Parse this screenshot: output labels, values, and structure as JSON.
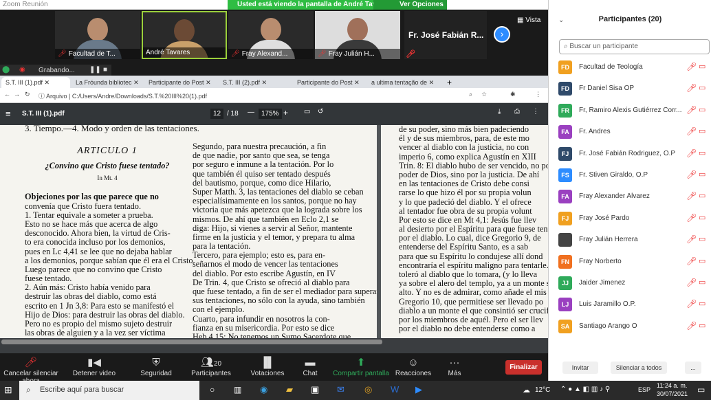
{
  "zoom": {
    "window_title": "Zoom Reunión",
    "share_banner": "Usted está viendo la pantalla de André Tavares",
    "view_options": "Ver Opciones",
    "view_label": "Vista",
    "recording": "Grabando..."
  },
  "video_tiles": [
    {
      "name": "Facultad de T..."
    },
    {
      "name": "André Tavares"
    },
    {
      "name": "Fray Alexand..."
    },
    {
      "name": "Fray Julián H..."
    }
  ],
  "next_tile_name": "Fr. José Fabián R...",
  "browser": {
    "tabs": [
      "S.T. III (1).pdf",
      "La Fróunda bibliotec",
      "Participante do Post",
      "S.T. III (2).pdf",
      "Participante do Post",
      "a ultima tentação de"
    ],
    "address_prefix": "Arquivo",
    "address": "C:/Users/Andre/Downloads/S.T.%20III%20(1).pdf"
  },
  "pdf": {
    "filename": "S.T. III (1).pdf",
    "page_current": "12",
    "page_total": "/ 18",
    "zoom": "175%"
  },
  "doc": {
    "col1": [
      "3.   Tiempo.—4.   Modo y orden de las tentaciones.",
      "",
      "ARTICULO 1",
      "¿Convino que Cristo fuese tentado?",
      "In Mt. 4",
      "",
      "Objeciones por las que parece que no",
      "convenía que Cristo fuera tentado.",
      "1.  Tentar equivale a someter a prueba.",
      "Esto no se hace más que acerca de algo",
      "desconocido. Ahora bien, la virtud de Cris-",
      "to era conocida incluso por los demonios,",
      "pues en Lc 4,41 se lee que no dejaba hablar",
      "a los demonios, porque sabían que él era el Cristo.",
      "Luego parece que no convino que Cristo",
      "fuese tentado.",
      "2.  Aún más: Cristo había venido para",
      "destruir las obras del diablo, como está",
      "escrito en 1 Jn 3,8: Para esto se manifestó el",
      "Hijo de Dios: para destruir las obras del diablo.",
      "Pero no es propio del mismo sujeto destruir",
      "las obras de alguien y a la vez ser víctima"
    ],
    "col2": [
      "Segundo, para nuestra precaución, a fin",
      "de que nadie, por santo que sea, se tenga",
      "por seguro e inmune a la tentación. Por lo",
      "que también él quiso ser tentado después",
      "del bautismo, porque, como dice Hilario,",
      "Super Matth. 3, las tentaciones del diablo se ceban",
      "especialísimamente en los santos, porque no hay",
      "victoria que más apetezca que la lograda sobre los",
      "mismos. De ahí que también en Eclo 2,1 se",
      "diga: Hijo, si vienes a servir al Señor, mantente",
      "firme en la justicia y el temor, y prepara tu alma",
      "para la tentación.",
      "Tercero, para ejemplo; esto es, para en-",
      "señarnos el modo de vencer las tentaciones",
      "del diablo. Por esto escribe Agustín, en IV",
      "De Trin. 4, que Cristo se ofreció al diablo para",
      "que fuese tentado, a fin de ser el mediador para superar",
      "sus tentaciones, no sólo con la ayuda, sino también",
      "con el ejemplo.",
      "Cuarto, para infundir en nosotros la con-",
      "fianza en su misericordia. Por esto se dice",
      "Heb 4,15: No tenemos un Sumo Sacerdote que"
    ],
    "col3": [
      "de su poder, sino más bien padeciendo",
      "él y de sus miembros, para, de este mo",
      "vencer al diablo con la justicia, no con",
      "imperio 6, como explica Agustín en XIII",
      "Trin. 8: El diablo hubo de ser vencido, no po",
      "poder de Dios, sino por la justicia. De ahí",
      "en las tentaciones de Cristo debe consi",
      "rarse lo que hizo él por su propia volun",
      "y lo que padeció del diablo. Y el ofrece",
      "al tentador fue obra de su propia volunt",
      "Por esto se dice en Mt 4,1: Jesús fue llev",
      "al desierto por el Espíritu para que fuese tent",
      "por el diablo. Lo cual, dice Gregorio 9, de",
      "entenderse del Espíritu Santo, es a sab",
      "para que su Espíritu lo condujese allí dond",
      "encontraría el espíritu maligno para tentarle. P",
      "toleró al diablo que lo tomara, (y lo lleva",
      "ya sobre el alero del templo, ya a un monte s",
      "alto. Y no es de admirar, como añade el mis",
      "Gregorio 10, que permitiese ser llevado po",
      "diablo a un monte el que consintió ser crucifi",
      "por los miembros de aquél. Pero el ser llev",
      "por el diablo no debe entenderse como a"
    ]
  },
  "controls": [
    {
      "icon": "mic-muted-icon",
      "label": "Cancelar silenciar ahora"
    },
    {
      "icon": "camera-icon",
      "label": "Detener video"
    },
    {
      "icon": "shield-icon",
      "label": "Seguridad"
    },
    {
      "icon": "people-icon",
      "label": "Participantes",
      "badge": "20"
    },
    {
      "icon": "chart-icon",
      "label": "Votaciones"
    },
    {
      "icon": "chat-icon",
      "label": "Chat"
    },
    {
      "icon": "share-icon",
      "label": "Compartir pantalla"
    },
    {
      "icon": "emoji-icon",
      "label": "Reacciones"
    },
    {
      "icon": "more-icon",
      "label": "Más"
    }
  ],
  "end_button": "Finalizar",
  "participants": {
    "title": "Participantes (20)",
    "search_placeholder": "Buscar un participante",
    "list": [
      {
        "initials": "FD",
        "name": "Facultad de Teología",
        "color": "#f0a020"
      },
      {
        "initials": "FD",
        "name": "Fr Daniel Sisa OP",
        "color": "#2f4a6a"
      },
      {
        "initials": "FR",
        "name": "Fr, Ramiro Alexis Gutiérrez Corr...",
        "color": "#2faa5a"
      },
      {
        "initials": "FA",
        "name": "Fr. Andres",
        "color": "#9a40c0"
      },
      {
        "initials": "FJ",
        "name": "Fr. José Fabián Rodriguez, O.P",
        "color": "#2f4a6a"
      },
      {
        "initials": "FS",
        "name": "Fr. Stiven Giraldo, O.P",
        "color": "#2d8cff"
      },
      {
        "initials": "FA",
        "name": "Fray Alexander Alvarez",
        "color": "#9a40c0"
      },
      {
        "initials": "FJ",
        "name": "Fray José Pardo",
        "color": "#f0a020"
      },
      {
        "initials": "",
        "name": "Fray Julián Herrera",
        "color": "#444444"
      },
      {
        "initials": "FN",
        "name": "Fray Norberto",
        "color": "#f07020"
      },
      {
        "initials": "JJ",
        "name": "Jaider Jimenez",
        "color": "#2faa5a"
      },
      {
        "initials": "LJ",
        "name": "Luis Jaramillo O.P.",
        "color": "#9a40c0"
      },
      {
        "initials": "SA",
        "name": "Santiago Arango O",
        "color": "#f0a020"
      }
    ],
    "invite": "Invitar",
    "mute_all": "Silenciar a todos",
    "more": "..."
  },
  "taskbar": {
    "search": "Escribe aquí para buscar",
    "weather": "12°C",
    "lang": "ESP",
    "time": "11:24 a. m.",
    "date": "30/07/2021"
  }
}
